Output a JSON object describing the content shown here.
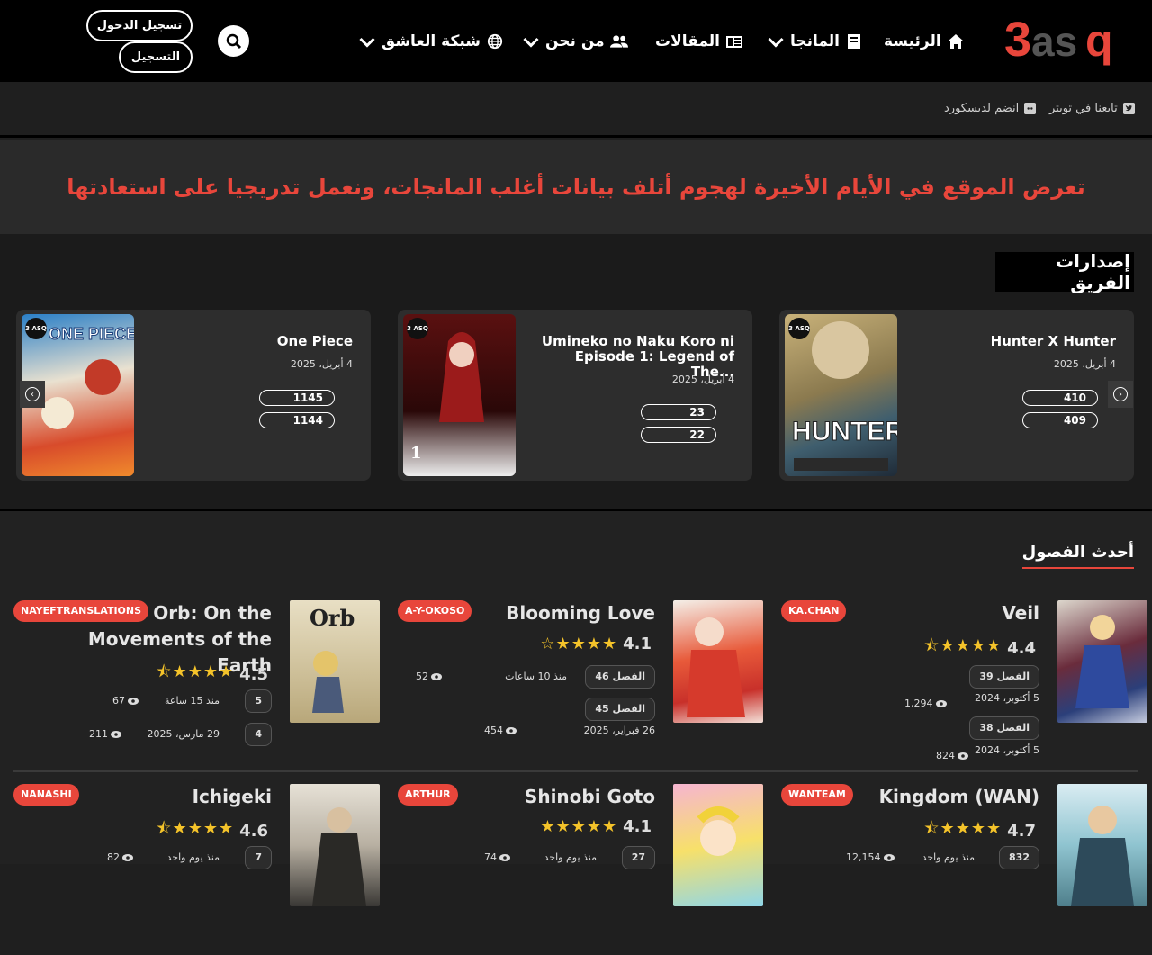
{
  "header": {
    "logo_text": "3asq",
    "nav": [
      {
        "label": "الرئيسة",
        "icon": "home-icon"
      },
      {
        "label": "المانجا",
        "icon": "book-icon"
      },
      {
        "label": "المقالات",
        "icon": "newspaper-icon"
      },
      {
        "label": "من نحن",
        "icon": "users-icon"
      },
      {
        "label": "شبكة العاشق",
        "icon": "globe-icon"
      }
    ],
    "login_label": "تسجيل الدخول",
    "register_label": "التسجيل"
  },
  "subbar": {
    "twitter_label": "تابعنا في تويتر",
    "discord_label": "انضم لديسكورد"
  },
  "notice": {
    "text": "تعرض الموقع في الأيام الأخيرة لهجوم أتلف بيانات أغلب المانجات، ونعمل تدريجيا على استعادتها"
  },
  "releases": {
    "title": "إصدارات الفريق",
    "items": [
      {
        "title": "Hunter X Hunter",
        "date": "4 أبريل، 2025",
        "chapters": [
          "410",
          "409"
        ]
      },
      {
        "title": "Umineko no Naku Koro ni Episode 1: Legend of The...",
        "date": "4 أبريل، 2025",
        "chapters": [
          "23",
          "22"
        ]
      },
      {
        "title": "One Piece",
        "date": "4 أبريل، 2025",
        "chapters": [
          "1145",
          "1144"
        ]
      }
    ],
    "badge": "3 ASQ"
  },
  "latest": {
    "title": "أحدث الفصول",
    "items": [
      {
        "title": "Veil",
        "team": "KA.CHAN",
        "rating": "4.4",
        "rows": [
          {
            "chapter": "الفصل 39",
            "time": "5 أكتوبر، 2024",
            "views": "1,294"
          },
          {
            "chapter": "الفصل 38",
            "time": "5 أكتوبر، 2024",
            "views": "824"
          }
        ]
      },
      {
        "title": "Blooming Love",
        "team": "A-Y-OKOSO",
        "rating": "4.1",
        "rows": [
          {
            "chapter": "الفصل 46",
            "time": "منذ 10 ساعات",
            "views": "52"
          },
          {
            "chapter": "الفصل 45",
            "time": "26 فبراير، 2025",
            "views": "454"
          }
        ]
      },
      {
        "title": "Orb: On the Movements of the Earth",
        "team": "NAYEFTRANSLATIONS",
        "rating": "4.5",
        "rows": [
          {
            "chapter": "5",
            "time": "منذ 15 ساعة",
            "views": "67"
          },
          {
            "chapter": "4",
            "time": "29 مارس، 2025",
            "views": "211"
          }
        ]
      },
      {
        "title": "Kingdom (WAN)",
        "team": "WANTEAM",
        "rating": "4.7",
        "rows": [
          {
            "chapter": "832",
            "time": "منذ يوم واحد",
            "views": "12,154"
          }
        ]
      },
      {
        "title": "Shinobi Goto",
        "team": "ARTHUR",
        "rating": "4.1",
        "rows": [
          {
            "chapter": "27",
            "time": "منذ يوم واحد",
            "views": "74"
          }
        ]
      },
      {
        "title": "Ichigeki",
        "team": "NANASHI",
        "rating": "4.6",
        "rows": [
          {
            "chapter": "7",
            "time": "منذ يوم واحد",
            "views": "82"
          }
        ]
      }
    ]
  },
  "colors": {
    "accent": "#e8463b",
    "star": "#f4c32a",
    "header_bg": "#000000"
  }
}
